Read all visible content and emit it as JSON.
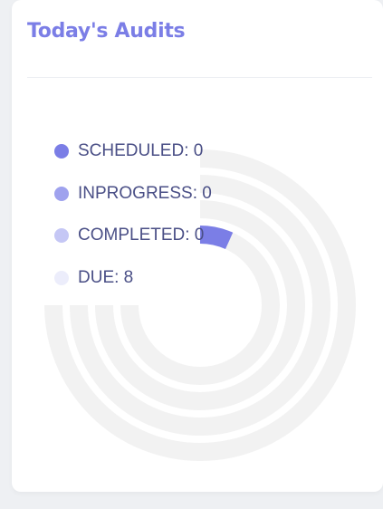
{
  "card": {
    "title": "Today's Audits"
  },
  "chart_data": {
    "type": "radialBar",
    "title": "",
    "series": [
      {
        "name": "SCHEDULED",
        "legend_label": "SCHEDULED: 0",
        "value": 0,
        "color": "#7b7ee6"
      },
      {
        "name": "INPROGRESS",
        "legend_label": "INPROGRESS: 0",
        "value": 0,
        "color": "#9fa2ee"
      },
      {
        "name": "COMPLETED",
        "legend_label": "COMPLETED: 0",
        "value": 0,
        "color": "#c5c7f5"
      },
      {
        "name": "DUE",
        "legend_label": "DUE: 8",
        "value": 8,
        "color": "#ecedfb"
      }
    ],
    "track_color": "#f2f2f2",
    "arc_sweep_degrees": 270,
    "legend_position": "left"
  }
}
